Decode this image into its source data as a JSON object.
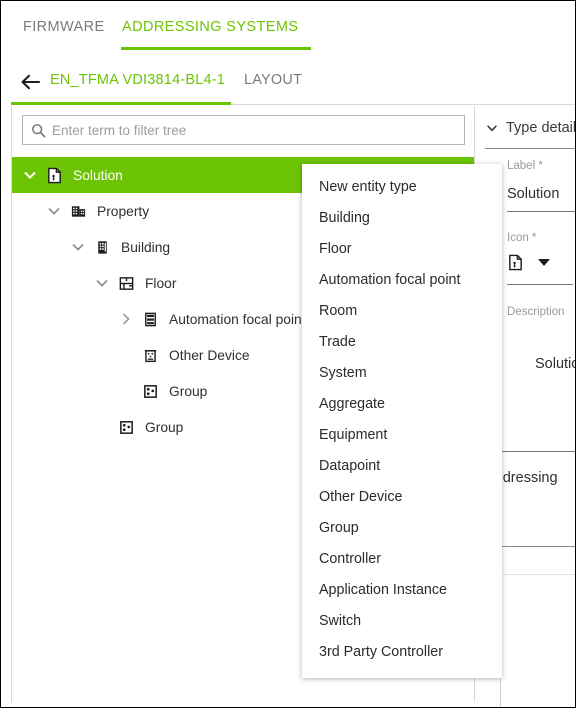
{
  "top_tabs": [
    {
      "label": "FIRMWARE",
      "active": false
    },
    {
      "label": "ADDRESSING SYSTEMS",
      "active": true
    }
  ],
  "breadcrumb": {
    "back_icon": "arrow-left-icon",
    "items": [
      {
        "label": "EN_TFMA VDI3814-BL4-1",
        "active": true
      },
      {
        "label": "LAYOUT",
        "active": false
      }
    ]
  },
  "search": {
    "icon": "search-icon",
    "placeholder": "Enter term to filter tree",
    "value": ""
  },
  "tree": {
    "nodes": [
      {
        "label": "Solution",
        "icon": "document-icon",
        "twisty": "expanded",
        "depth": 0,
        "selected": true
      },
      {
        "label": "Property",
        "icon": "property-icon",
        "twisty": "expanded",
        "depth": 1,
        "selected": false
      },
      {
        "label": "Building",
        "icon": "building-icon",
        "twisty": "expanded",
        "depth": 2,
        "selected": false
      },
      {
        "label": "Floor",
        "icon": "floor-icon",
        "twisty": "expanded",
        "depth": 3,
        "selected": false
      },
      {
        "label": "Automation focal point",
        "icon": "automation-icon",
        "twisty": "collapsed",
        "depth": 4,
        "selected": false
      },
      {
        "label": "Other Device",
        "icon": "device-icon",
        "twisty": "none",
        "depth": 4,
        "selected": false
      },
      {
        "label": "Group",
        "icon": "group-icon",
        "twisty": "none",
        "depth": 4,
        "selected": false
      },
      {
        "label": "Group",
        "icon": "group-icon",
        "twisty": "none",
        "depth": 3,
        "selected": false
      }
    ]
  },
  "menu": {
    "items": [
      "New entity type",
      "Building",
      "Floor",
      "Automation focal point",
      "Room",
      "Trade",
      "System",
      "Aggregate",
      "Equipment",
      "Datapoint",
      "Other Device",
      "Group",
      "Controller",
      "Application Instance",
      "Switch",
      "3rd Party Controller"
    ]
  },
  "details": {
    "title": "Type details",
    "chevron": "chevron-down-icon",
    "label_field": {
      "label": "Label *",
      "value": "Solution"
    },
    "icon_field": {
      "label": "Icon *",
      "icon": "document-icon",
      "caret": "caret-down-icon"
    },
    "description_field": {
      "label": "Description",
      "value": "Solution"
    },
    "section": {
      "label": "Addressing"
    }
  },
  "colors": {
    "accent_green": "#6cc404",
    "tab_inactive": "#7b7b7b",
    "text": "#2f2f2f",
    "muted": "#9a9a9a",
    "border": "#d9d9d9"
  }
}
